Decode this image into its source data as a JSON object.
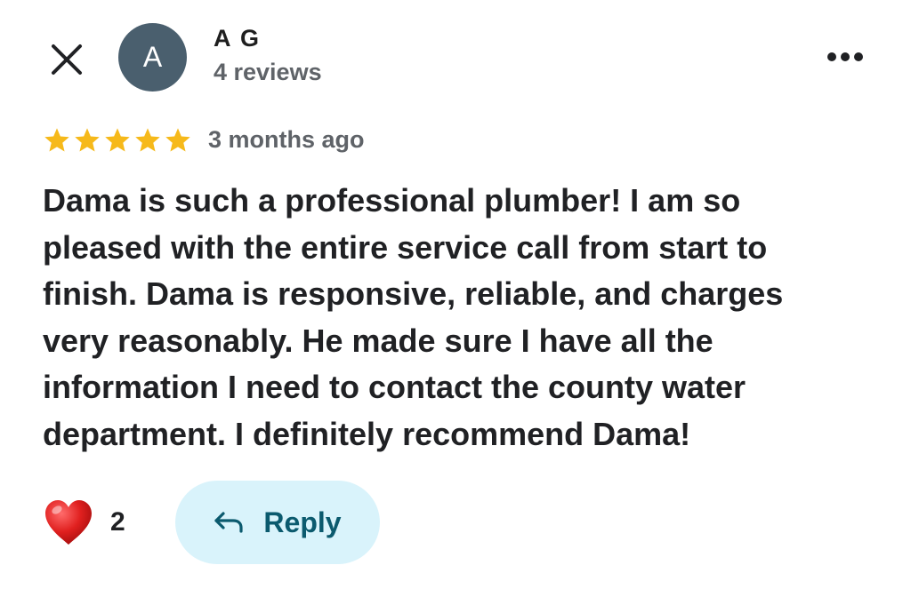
{
  "header": {
    "close_icon": "close-icon",
    "avatar_letter": "A",
    "avatar_color": "#4a5f6e",
    "reviewer_name": "A G",
    "review_count": "4 reviews",
    "more_icon": "more-horizontal-icon"
  },
  "review": {
    "rating": 5,
    "max_rating": 5,
    "star_color": "#f6b91a",
    "date": "3 months ago",
    "text": "Dama is such a professional plumber! I am so\npleased with the entire service call from start to\nfinish.  Dama is responsive, reliable, and charges\nvery reasonably.  He made sure I have all the\ninformation I need to contact the county water\ndepartment.  I definitely recommend Dama!"
  },
  "actions": {
    "like_icon": "heart-icon",
    "like_count": "2",
    "reply_icon": "reply-arrow-icon",
    "reply_label": "Reply",
    "reply_bg": "#d9f3fb",
    "reply_text_color": "#0b5a6e"
  }
}
